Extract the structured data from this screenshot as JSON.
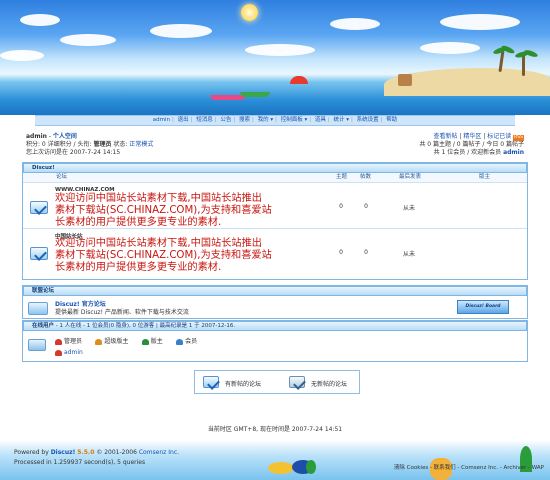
{
  "nav": {
    "items": [
      "admin",
      "退出",
      "短消息",
      "公告",
      "搜索",
      "我的 ▾",
      "控制面板 ▾",
      "道具",
      "统计 ▾",
      "系统设置",
      "帮助"
    ]
  },
  "user": {
    "name": "admin",
    "space": "个人空间",
    "line2_a": "积分: 0 详细积分 / 头衔:",
    "title": "管理员",
    "line2_b": "状态:",
    "status": "正常模式",
    "last_visit": "您上次访问是在 2007-7-24 14:15"
  },
  "toplinks": {
    "links": [
      "查看新帖",
      "精华区",
      "标记已读"
    ],
    "rss_label": "RSS",
    "stats1": "共 0 篇主题 / 0 篇帖子 / 今日 0 篇帖子",
    "stats2_a": "共 1 位会员 / 欢迎新会员",
    "stats2_user": "admin"
  },
  "category": {
    "title": "Discuz!",
    "headers": [
      "论坛",
      "主题",
      "帖数",
      "最后发表",
      "版主"
    ],
    "forums": [
      {
        "name": "WWW.CHINAZ.COM",
        "desc": [
          "欢迎访问中国站长站素材下载,中国站长站推出",
          "素材下载站(SC.CHINAZ.COM),为支持和喜爱站",
          "长素材的用户提供更多更专业的素材."
        ],
        "topics": "0",
        "posts": "0",
        "last": "从未",
        "mod": ""
      },
      {
        "name": "中国站长站",
        "desc": [
          "欢迎访问中国站长站素材下载,中国站长站推出",
          "素材下载站(SC.CHINAZ.COM),为支持和喜爱站",
          "长素材的用户提供更多更专业的素材."
        ],
        "topics": "0",
        "posts": "0",
        "last": "从未",
        "mod": ""
      }
    ]
  },
  "links_box": {
    "title": "联盟论坛",
    "name": "Discuz! 官方论坛",
    "desc": "提供最新 Discuz! 产品新闻、软件下载与技术交流",
    "banner_text": "Discuz! Board"
  },
  "online": {
    "label": "在线用户",
    "text": "- 1 人在线 - 1 位会员(0 隐身), 0 位游客 | 最高纪录是 1 于 2007-12-16.",
    "groups": [
      "管理员",
      "超级版主",
      "版主",
      "会员"
    ],
    "group_colors": [
      "#d6382f",
      "#e08c1f",
      "#2a8f3a",
      "#3a7fcf"
    ],
    "user": "admin"
  },
  "legend": {
    "new": "有新帖的论坛",
    "nonew": "无新帖的论坛"
  },
  "timezone": "当前时区 GMT+8, 现在时间是 2007-7-24 14:51",
  "footer": {
    "powered_a": "Powered by",
    "product": "Discuz!",
    "version": "5.5.0",
    "copyright": "© 2001-2006",
    "company": "Comsenz Inc.",
    "processed": "Processed in 1.259937 second(s), 5 queries",
    "right_links": "清除 Cookies - 联系我们 - Comsenz Inc. - Archiver - WAP"
  }
}
